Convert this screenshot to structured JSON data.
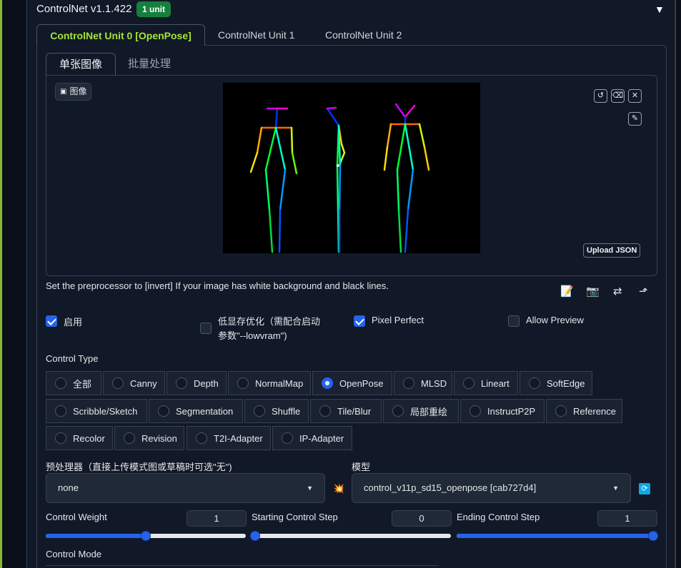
{
  "header": {
    "title": "ControlNet v1.1.422",
    "badge": "1 unit",
    "collapse_icon": "triangle-down-icon"
  },
  "unit_tabs": [
    {
      "label": "ControlNet Unit 0 [OpenPose]",
      "active": true
    },
    {
      "label": "ControlNet Unit 1",
      "active": false
    },
    {
      "label": "ControlNet Unit 2",
      "active": false
    }
  ],
  "mode_tabs": [
    {
      "label": "单张图像",
      "active": true
    },
    {
      "label": "批量处理",
      "active": false
    }
  ],
  "image_panel": {
    "label": "图像",
    "upload_json": "Upload JSON"
  },
  "hint": "Set the preprocessor to [invert] If your image has white background and black lines.",
  "options": {
    "enable": {
      "label": "启用",
      "checked": true
    },
    "lowvram": {
      "label": "低显存优化（需配合启动参数\"--lowvram\")",
      "line1": "低显存优化（需配合启动",
      "line2": "参数\"--lowvram\")",
      "checked": false
    },
    "pixel_perfect": {
      "label": "Pixel Perfect",
      "checked": true
    },
    "allow_preview": {
      "label": "Allow Preview",
      "checked": false
    }
  },
  "control_type": {
    "label": "Control Type",
    "selected": "OpenPose",
    "options": [
      "全部",
      "Canny",
      "Depth",
      "NormalMap",
      "OpenPose",
      "MLSD",
      "Lineart",
      "SoftEdge",
      "Scribble/Sketch",
      "Segmentation",
      "Shuffle",
      "Tile/Blur",
      "局部重绘",
      "InstructP2P",
      "Reference",
      "Recolor",
      "Revision",
      "T2I-Adapter",
      "IP-Adapter"
    ]
  },
  "preprocessor": {
    "label": "预处理器（直接上传模式图或草稿时可选\"无\")",
    "value": "none"
  },
  "model": {
    "label": "模型",
    "value": "control_v11p_sd15_openpose [cab727d4]"
  },
  "control_weight": {
    "label": "Control Weight",
    "value": "1",
    "fraction": 0.5
  },
  "starting_step": {
    "label": "Starting Control Step",
    "value": "0",
    "fraction": 0.0
  },
  "ending_step": {
    "label": "Ending Control Step",
    "value": "1",
    "fraction": 1.0
  },
  "control_mode": {
    "label": "Control Mode"
  },
  "colors": {
    "accent": "#2563eb",
    "active_tab": "#a3e635",
    "badge": "#15803d",
    "rail": "#8bb733"
  }
}
